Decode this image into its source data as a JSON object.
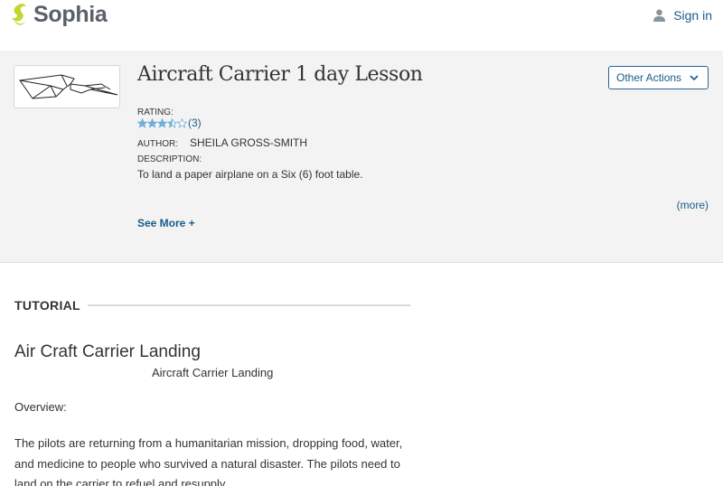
{
  "header": {
    "brand": "Sophia",
    "brand_color": "#c2d62e",
    "sign_in_label": "Sign in",
    "icons": {
      "logo": "sophia-logo-icon",
      "user": "user-icon"
    }
  },
  "lesson": {
    "title": "Aircraft Carrier 1 day Lesson",
    "other_actions_label": "Other Actions",
    "rating_label": "RATING:",
    "rating_value": 3.5,
    "rating_max": 5,
    "rating_count": "(3)",
    "author_label": "AUTHOR:",
    "author": "SHEILA GROSS-SMITH",
    "description_label": "DESCRIPTION:",
    "description": "To land a paper airplane on a Six (6) foot table.",
    "more_label": "(more)",
    "see_more_label": "See More +",
    "thumbnail_icon": "paper-airplane-icon"
  },
  "content": {
    "section_label": "TUTORIAL",
    "heading": "Air Craft Carrier Landing",
    "subheading": "Aircraft Carrier Landing",
    "overview": "Overview:",
    "paragraph": "The pilots are returning from a humanitarian mission, dropping food, water, and medicine to people who survived a natural disaster. The pilots need to land on the carrier to refuel and resupply."
  },
  "colors": {
    "link": "#1a5c8a",
    "star_filled": "#6fb0d8",
    "panel_bg": "#f3f3f3"
  }
}
